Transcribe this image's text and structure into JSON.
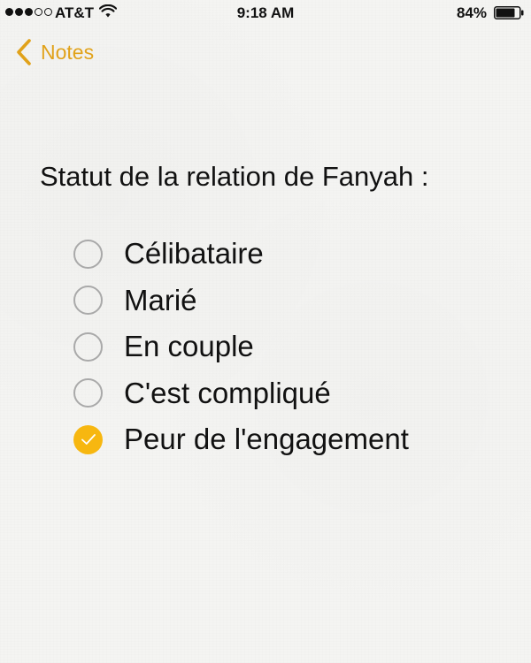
{
  "status_bar": {
    "carrier": "AT&T",
    "signal_bars": 3,
    "signal_total": 5,
    "time": "9:18 AM",
    "battery_percent": "84%",
    "battery_level": 0.84
  },
  "nav": {
    "back_label": "Notes"
  },
  "note": {
    "title": "Statut de la relation de Fanyah :",
    "checklist": [
      {
        "label": "Célibataire",
        "checked": false
      },
      {
        "label": "Marié",
        "checked": false
      },
      {
        "label": "En couple",
        "checked": false
      },
      {
        "label": "C'est compliqué",
        "checked": false
      },
      {
        "label": "Peur de l'engagement",
        "checked": true
      }
    ]
  },
  "colors": {
    "accent": "#e1a21a",
    "check_fill": "#f7b710",
    "unchecked_border": "#a9a9a9"
  }
}
